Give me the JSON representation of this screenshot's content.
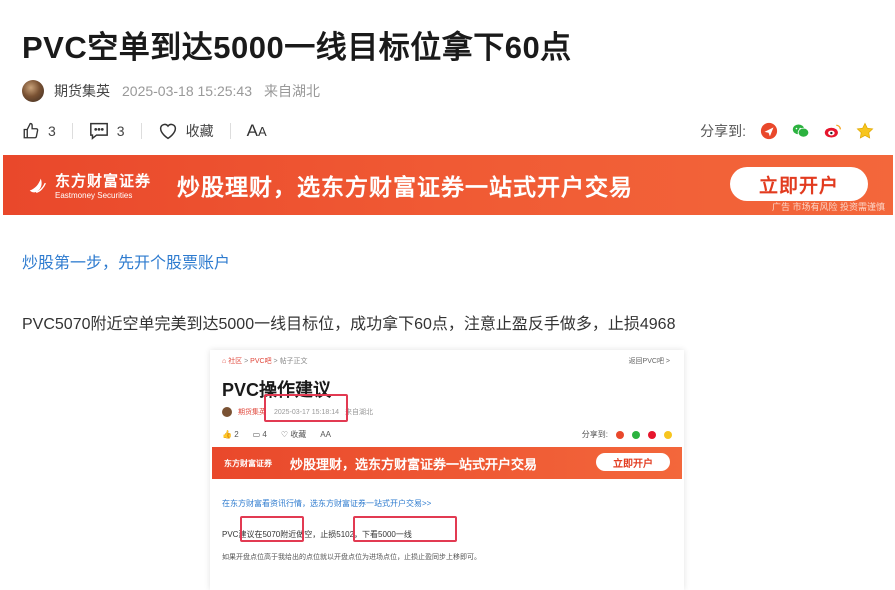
{
  "article": {
    "title": "PVC空单到达5000一线目标位拿下60点",
    "author": "期货集英",
    "date": "2025-03-18 15:25:43",
    "location": "来自湖北"
  },
  "actions": {
    "like_count": "3",
    "comment_count": "3",
    "favorite_label": "收藏",
    "font_big": "A",
    "font_small": "A",
    "share_label": "分享到:"
  },
  "share_icons": [
    "share-red-icon",
    "wechat-icon",
    "weibo-icon",
    "star-icon"
  ],
  "banner": {
    "logo_cn": "东方财富证券",
    "logo_en": "Eastmoney Securities",
    "slogan": "炒股理财，选东方财富证券一站式开户交易",
    "button": "立即开户",
    "ad_note": "广告 市场有风险 投资需谨慎"
  },
  "content": {
    "link": "炒股第一步，先开个股票账户",
    "paragraph": "PVC5070附近空单完美到达5000一线目标位，成功拿下60点，注意止盈反手做多，止损4968"
  },
  "screenshot": {
    "breadcrumb_home": "社区",
    "breadcrumb_bar": "PVC吧",
    "breadcrumb_page": "帖子正文",
    "back": "返回PVC吧 >",
    "title": "PVC操作建议",
    "author": "期货集英",
    "date": "2025-03-17 15:18:14",
    "location": "来自湖北",
    "like_count": "2",
    "comment_count": "4",
    "favorite_label": "收藏",
    "font_label": "AA",
    "share_label": "分享到:",
    "banner_logo": "东方财富证券",
    "banner_slogan": "炒股理财，选东方财富证券一站式开户交易",
    "banner_button": "立即开户",
    "link": "在东方财富看资讯行情，选东方财富证券一站式开户交易>>",
    "paragraph": "PVC建议在5070附近做空，止损5102，下看5000一线",
    "paragraph2": "如果开盘点位高于我给出的点位就以开盘点位为进场点位，止损止盈同步上移即可。"
  },
  "colors": {
    "accent_red": "#e9482b",
    "link_blue": "#2e7bcf",
    "highlight": "#e23a52"
  }
}
